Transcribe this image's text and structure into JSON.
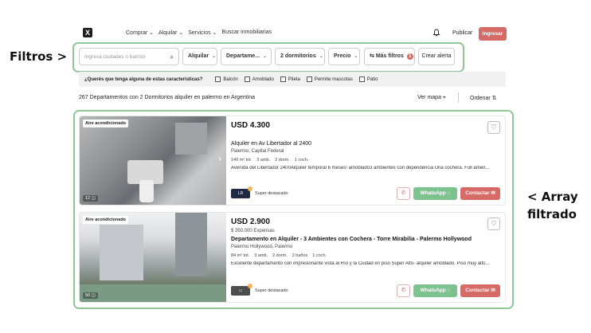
{
  "annotations": {
    "filtros": "Filtros >",
    "array_line1": "< Array",
    "array_line2": "filtrado"
  },
  "header": {
    "logo": "X",
    "nav": [
      "Comprar ⌄",
      "Alquilar ⌄",
      "Servicios ⌄",
      "Buscar inmobiliarias"
    ],
    "publicar": "Publicar",
    "ingresar": "Ingresar"
  },
  "filters": {
    "search_placeholder": "Ingresá ciudades o barrios",
    "operation": "Alquilar",
    "type": "Departame...",
    "rooms": "2 dormitorios",
    "price": "Precio",
    "more": "Más filtros",
    "more_count": "1",
    "alert": "Crear alerta"
  },
  "features": {
    "question": "¿Querés que tenga alguna de estas características?",
    "items": [
      "Balcón",
      "Amoblado",
      "Pileta",
      "Permite mascotas",
      "Patio"
    ]
  },
  "results": {
    "summary": "267 Departamentos con 2 Dormitorios alquiler en palermo en Argentina",
    "map": "Ver mapa",
    "sort": "Ordenar"
  },
  "listings": [
    {
      "tag": "Aire acondicionado",
      "photo_count": "12",
      "price": "USD 4.300",
      "expensas": "",
      "title": "Alquiler en Av Libertador al 2400",
      "location": "Palermo, Capital Federal",
      "specs": [
        "140 m² tot.",
        "3 amb.",
        "2 dorm.",
        "1 coch."
      ],
      "description": "Avenida del Libertador 2400Alquiler temporal 6 meses! amoblado3 ambientes con dependencia Una cochera. Full amen...",
      "agency_label": "Super destacado",
      "whatsapp": "WhatsApp",
      "contact": "Contactar"
    },
    {
      "tag": "Aire acondicionado",
      "photo_count": "50",
      "price": "USD 2.900",
      "expensas": "$ 350.000 Expensas",
      "title": "Departamento en Alquiler - 3 Ambientes con Cochera - Torre Mirabilia - Palermo Hollywood",
      "location": "Palermo Hollywood, Palermo",
      "specs": [
        "84 m² tot.",
        "3 amb.",
        "2 dorm.",
        "2 baños",
        "1 coch."
      ],
      "description": "Excelente departamento con impresionante vista al Río y la Ciudad en piso Super Alto- alquiler amoblado. Piso muy alto...",
      "agency_label": "Super destacado",
      "whatsapp": "WhatsApp",
      "contact": "Contactar"
    }
  ],
  "colors": {
    "accent": "#d66a66",
    "whatsapp": "#7ec38f",
    "annotation_box": "#8fc79a"
  }
}
